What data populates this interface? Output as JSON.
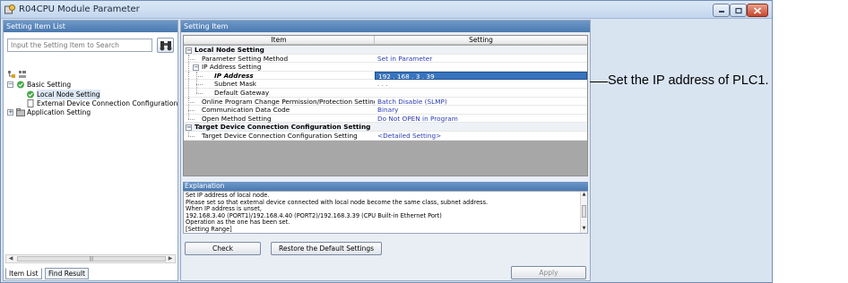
{
  "window": {
    "title": "R04CPU Module Parameter",
    "icon": "module-parameter-icon",
    "controls": [
      "minimize-icon",
      "maximize-icon",
      "close-icon"
    ]
  },
  "left_panel": {
    "header": "Setting Item List",
    "search_placeholder": "Input the Setting Item to Search",
    "search_icon": "binoculars-icon",
    "tree": [
      {
        "label": "Basic Setting",
        "expanded": true,
        "icon": "check-folder-icon"
      },
      {
        "label": "Local Node Setting",
        "selected": true,
        "icon": "check-icon"
      },
      {
        "label": "External Device Connection Configuration",
        "icon": "document-icon"
      },
      {
        "label": "Application Setting",
        "expanded": false,
        "icon": "folder-icon"
      }
    ],
    "tabs": [
      "Item List",
      "Find Result"
    ]
  },
  "right_panel": {
    "header": "Setting Item",
    "grid": {
      "columns": [
        "Item",
        "Setting"
      ],
      "rows": [
        {
          "item": "Local Node Setting",
          "setting": "",
          "type": "section"
        },
        {
          "item": "Parameter Setting Method",
          "setting": "Set in Parameter",
          "type": "field"
        },
        {
          "item": "IP Address Setting",
          "setting": "",
          "type": "group"
        },
        {
          "item": "IP Address",
          "setting": "192 . 168 .  3 . 39",
          "type": "ip"
        },
        {
          "item": "Subnet Mask",
          "setting": ".      .      .",
          "type": "sub"
        },
        {
          "item": "Default Gateway",
          "setting": "",
          "type": "sub"
        },
        {
          "item": "Online Program Change Permission/Protection Setting",
          "setting": "Batch Disable (SLMP)",
          "type": "field"
        },
        {
          "item": "Communication Data Code",
          "setting": "Binary",
          "type": "field"
        },
        {
          "item": "Open Method Setting",
          "setting": "Do Not OPEN in Program",
          "type": "field"
        },
        {
          "item": "Target Device Connection Configuration Setting",
          "setting": "",
          "type": "section"
        },
        {
          "item": "Target Device Connection Configuration Setting",
          "setting": "<Detailed Setting>",
          "type": "field"
        }
      ]
    },
    "explanation": {
      "header": "Explanation",
      "lines": [
        "Set IP address of local node.",
        "Please set so that external device connected with local node become the same class, subnet address.",
        "When IP address is unset,",
        "192.168.3.40 (PORT1)/192.168.4.40 (PORT2)/192.168.3.39 (CPU Built-in Ethernet Port)",
        "Operation as the one has been set.",
        "[Setting Range]"
      ]
    },
    "buttons": {
      "check": "Check",
      "restore": "Restore the Default Settings",
      "apply": "Apply"
    }
  },
  "annotation": {
    "text": "Set the IP address of PLC1."
  }
}
